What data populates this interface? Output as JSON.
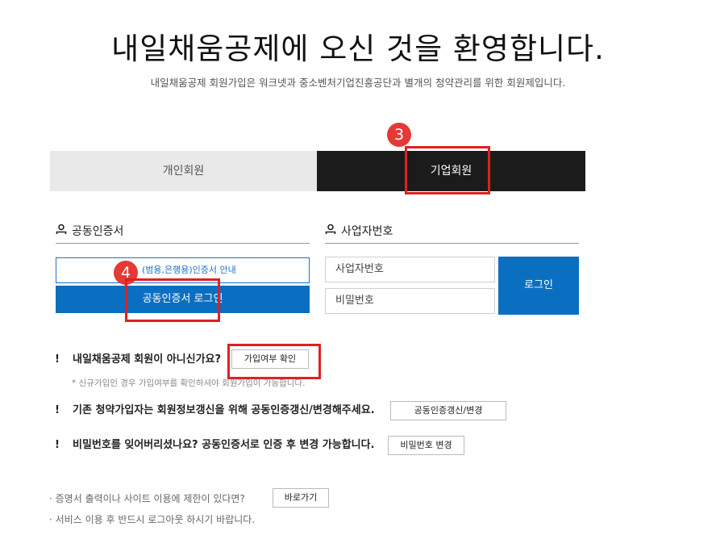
{
  "header": {
    "title": "내일채움공제에 오신 것을 환영합니다.",
    "subtitle": "내일채움공제 회원가입은 워크넷과 중소벤처기업진흥공단과 별개의 청약관리를 위한 회원제입니다."
  },
  "tabs": {
    "person": "개인회원",
    "company": "기업회원"
  },
  "markers": {
    "step3": "3",
    "step4": "4"
  },
  "certificate": {
    "heading": "공동인증서",
    "info_link": "(범용,은행용)인증서 안내",
    "login_button": "공동인증서 로그인"
  },
  "business": {
    "heading": "사업자번호",
    "id_placeholder": "사업자번호",
    "pw_placeholder": "비밀번호",
    "login_button": "로그인"
  },
  "notices": {
    "member_question": "내일채움공제 회원이 아니신가요?",
    "member_check_button": "가입여부 확인",
    "member_hint": "* 신규가입인 경우 가입여부를 확인하셔야 회원가입이 가능합니다.",
    "renew_text": "기존 청약가입자는 회원정보갱신을 위해 공동인증갱신/변경해주세요.",
    "renew_button": "공동인증갱신/변경",
    "password_text": "비밀번호를 잊어버리셨나요? 공동인증서로 인증 후 변경 가능합니다.",
    "password_button": "비밀번호 변경"
  },
  "footer": {
    "restriction_text": "· 증명서 출력이나 사이트 이용에 제한이 있다면?",
    "shortcut_button": "바로가기",
    "logout_text": "· 서비스 이용 후 반드시 로그아웃 하시기 바랍니다."
  },
  "colors": {
    "accent": "#0b6fc1",
    "highlight": "#e02020",
    "active_tab": "#1b1b1b"
  }
}
